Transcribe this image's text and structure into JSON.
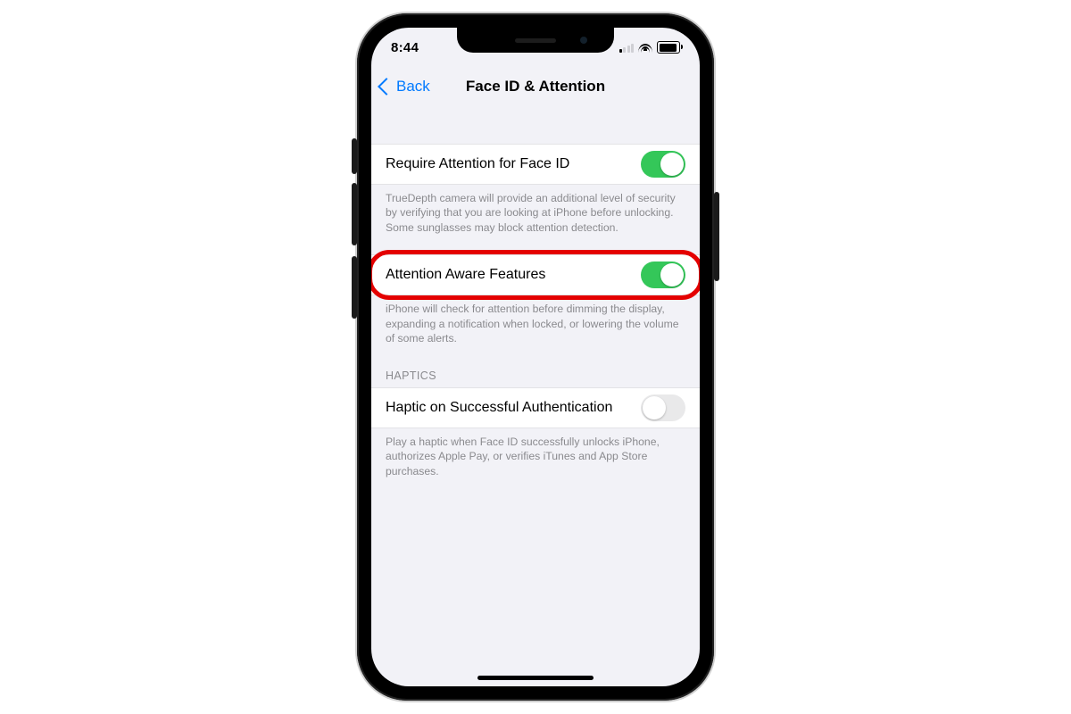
{
  "statusbar": {
    "time": "8:44"
  },
  "nav": {
    "back": "Back",
    "title": "Face ID & Attention"
  },
  "groups": [
    {
      "rows": [
        {
          "label": "Require Attention for Face ID",
          "on": true
        }
      ],
      "footer": "TrueDepth camera will provide an additional level of security by verifying that you are looking at iPhone before unlocking. Some sunglasses may block attention detection."
    },
    {
      "rows": [
        {
          "label": "Attention Aware Features",
          "on": true,
          "highlighted": true
        }
      ],
      "footer": "iPhone will check for attention before dimming the display, expanding a notification when locked, or lowering the volume of some alerts."
    },
    {
      "header": "HAPTICS",
      "rows": [
        {
          "label": "Haptic on Successful Authentication",
          "on": false
        }
      ],
      "footer": "Play a haptic when Face ID successfully unlocks iPhone, authorizes Apple Pay, or verifies iTunes and App Store purchases."
    }
  ]
}
